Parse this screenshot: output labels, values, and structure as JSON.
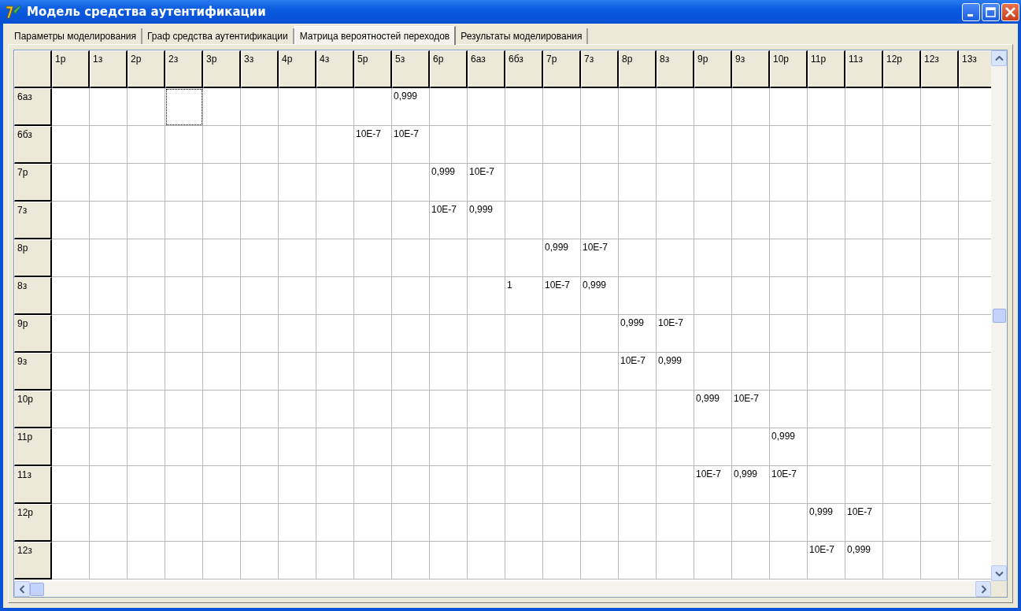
{
  "window": {
    "title": "Модель средства аутентификации"
  },
  "tabs": [
    {
      "label": "Параметры моделирования",
      "selected": false
    },
    {
      "label": "Граф средства аутентификации",
      "selected": false
    },
    {
      "label": "Матрица вероятностей переходов",
      "selected": true
    },
    {
      "label": "Результаты моделирования",
      "selected": false
    }
  ],
  "table": {
    "columns": [
      "1р",
      "1з",
      "2р",
      "2з",
      "3р",
      "3з",
      "4р",
      "4з",
      "5р",
      "5з",
      "6р",
      "6аз",
      "6бз",
      "7р",
      "7з",
      "8р",
      "8з",
      "9р",
      "9з",
      "10р",
      "11р",
      "11з",
      "12р",
      "12з",
      "13з"
    ],
    "rows": [
      {
        "label": "6аз",
        "cells": [
          {},
          {},
          {},
          {
            "focused": true
          },
          {},
          {},
          {},
          {},
          {},
          {
            "value": "0,999"
          }
        ]
      },
      {
        "label": "6бз",
        "cells": [
          {},
          {},
          {},
          {},
          {},
          {},
          {},
          {},
          {
            "value": "10E-7"
          },
          {
            "value": "10E-7"
          }
        ]
      },
      {
        "label": "7р",
        "cells": [
          {},
          {},
          {},
          {},
          {},
          {},
          {},
          {},
          {},
          {},
          {
            "value": "0,999"
          },
          {
            "value": "10E-7"
          }
        ]
      },
      {
        "label": "7з",
        "cells": [
          {},
          {},
          {},
          {},
          {},
          {},
          {},
          {},
          {},
          {},
          {
            "value": "10E-7"
          },
          {
            "value": "0,999"
          }
        ]
      },
      {
        "label": "8р",
        "cells": [
          {},
          {},
          {},
          {},
          {},
          {},
          {},
          {},
          {},
          {},
          {},
          {},
          {},
          {
            "value": "0,999"
          },
          {
            "value": "10E-7"
          }
        ]
      },
      {
        "label": "8з",
        "cells": [
          {},
          {},
          {},
          {},
          {},
          {},
          {},
          {},
          {},
          {},
          {},
          {},
          {
            "value": "1"
          },
          {
            "value": "10E-7"
          },
          {
            "value": "0,999"
          }
        ]
      },
      {
        "label": "9р",
        "cells": [
          {},
          {},
          {},
          {},
          {},
          {},
          {},
          {},
          {},
          {},
          {},
          {},
          {},
          {},
          {},
          {
            "value": "0,999"
          },
          {
            "value": "10E-7"
          }
        ]
      },
      {
        "label": "9з",
        "cells": [
          {},
          {},
          {},
          {},
          {},
          {},
          {},
          {},
          {},
          {},
          {},
          {},
          {},
          {},
          {},
          {
            "value": "10E-7"
          },
          {
            "value": "0,999"
          }
        ]
      },
      {
        "label": "10р",
        "cells": [
          {},
          {},
          {},
          {},
          {},
          {},
          {},
          {},
          {},
          {},
          {},
          {},
          {},
          {},
          {},
          {},
          {},
          {
            "value": "0,999"
          },
          {
            "value": "10E-7"
          }
        ]
      },
      {
        "label": "11р",
        "cells": [
          {},
          {},
          {},
          {},
          {},
          {},
          {},
          {},
          {},
          {},
          {},
          {},
          {},
          {},
          {},
          {},
          {},
          {},
          {},
          {
            "value": "0,999"
          }
        ]
      },
      {
        "label": "11з",
        "cells": [
          {},
          {},
          {},
          {},
          {},
          {},
          {},
          {},
          {},
          {},
          {},
          {},
          {},
          {},
          {},
          {},
          {},
          {
            "value": "10E-7"
          },
          {
            "value": "0,999"
          },
          {
            "value": "10E-7"
          }
        ]
      },
      {
        "label": "12р",
        "cells": [
          {},
          {},
          {},
          {},
          {},
          {},
          {},
          {},
          {},
          {},
          {},
          {},
          {},
          {},
          {},
          {},
          {},
          {},
          {},
          {},
          {
            "value": "0,999"
          },
          {
            "value": "10E-7"
          }
        ]
      },
      {
        "label": "12з",
        "cells": [
          {},
          {},
          {},
          {},
          {},
          {},
          {},
          {},
          {},
          {},
          {},
          {},
          {},
          {},
          {},
          {},
          {},
          {},
          {},
          {},
          {
            "value": "10E-7"
          },
          {
            "value": "0,999"
          }
        ]
      }
    ]
  }
}
